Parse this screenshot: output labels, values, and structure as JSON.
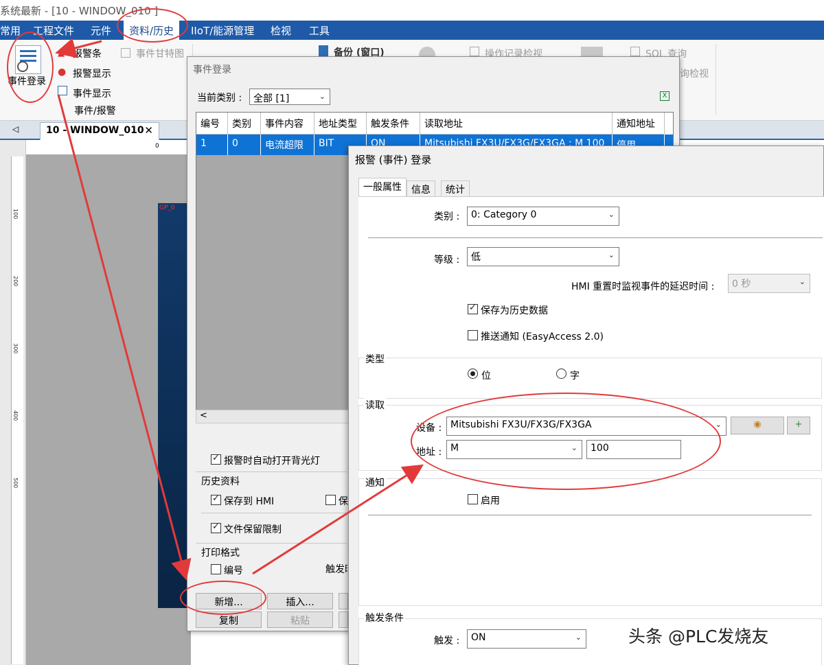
{
  "window_title": "系统最新 - [10 - WINDOW_010 ]",
  "menu": [
    "常用",
    "工程文件",
    "元件",
    "资料/历史",
    "IIoT/能源管理",
    "检视",
    "工具"
  ],
  "ribbon": {
    "event_login": "事件登录",
    "alarm_bar": "报警条",
    "alarm_display": "报警显示",
    "event_display": "事件显示",
    "event_gantt": "事件甘特图",
    "group_label": "事件/报警",
    "backup": "备份 (窗口)",
    "op_record_view": "操作记录检视",
    "sql_query": "SQL 查询",
    "query_view": "询检视"
  },
  "doc_tab": {
    "title": "10 - WINDOW_010",
    "close": "✕"
  },
  "ruler": {
    "ticks": [
      "100",
      "200",
      "300",
      "400",
      "500"
    ],
    "top_tick": "0"
  },
  "preview": {
    "label": "GP_0"
  },
  "dlg1": {
    "title": "事件登录",
    "category_label": "当前类别 :",
    "category_value": "全部 [1]",
    "columns": [
      "编号",
      "类别",
      "事件内容",
      "地址类型",
      "触发条件",
      "读取地址",
      "通知地址"
    ],
    "row": [
      "1",
      "0",
      "电流超限",
      "BIT",
      "ON",
      "Mitsubishi FX3U/FX3G/FX3GA : M 100",
      "停用"
    ],
    "backlight": "报警时自动打开背光灯",
    "history_label": "历史资料",
    "save_hmi": "保存到 HMI",
    "save_other": "保",
    "file_retain": "文件保留限制",
    "print_label": "打印格式",
    "print_no": "编号",
    "print_trigger": "触发时",
    "btn_add": "新增...",
    "btn_insert": "插入...",
    "btn_copy": "复制",
    "btn_paste": "粘贴"
  },
  "dlg2": {
    "title": "报警 (事件) 登录",
    "tabs": [
      "一般属性",
      "信息",
      "统计"
    ],
    "category_label": "类别 :",
    "category_value": "0: Category 0",
    "level_label": "等级 :",
    "level_value": "低",
    "delay_label": "HMI 重置时监视事件的延迟时间 :",
    "delay_value": "0 秒",
    "save_history": "保存为历史数据",
    "push_notify": "推送通知 (EasyAccess 2.0)",
    "type_label": "类型",
    "type_bit": "位",
    "type_word": "字",
    "read_label": "读取",
    "device_label": "设备 :",
    "device_value": "Mitsubishi FX3U/FX3G/FX3GA",
    "address_label": "地址 :",
    "address_type": "M",
    "address_value": "100",
    "notify_label": "通知",
    "notify_enable": "启用",
    "trigger_group": "触发条件",
    "trigger_label": "触发 :",
    "trigger_value": "ON"
  },
  "watermark": "头条 @PLC发烧友",
  "colors": {
    "menubar": "#1e5aa8",
    "selection": "#0f73d6",
    "annotation": "#e23a3a"
  }
}
